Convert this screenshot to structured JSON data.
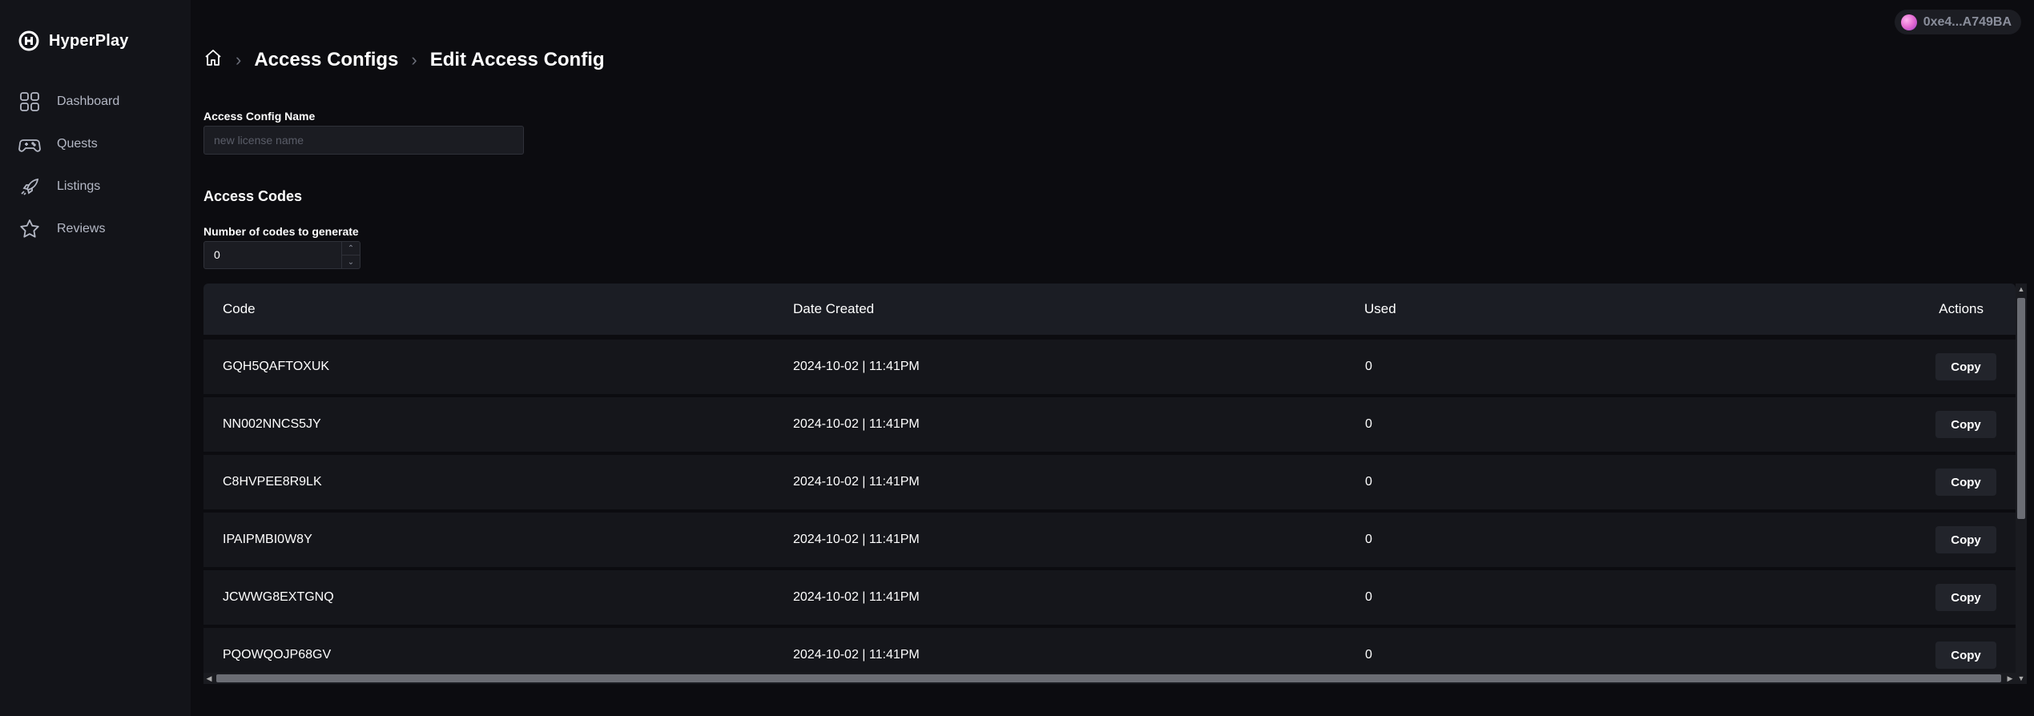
{
  "app": {
    "name": "HyperPlay"
  },
  "sidebar": {
    "items": [
      {
        "label": "Dashboard",
        "icon": "dashboard-icon"
      },
      {
        "label": "Quests",
        "icon": "gamepad-icon"
      },
      {
        "label": "Listings",
        "icon": "rocket-icon"
      },
      {
        "label": "Reviews",
        "icon": "star-icon"
      }
    ]
  },
  "wallet": {
    "address": "0xe4...A749BA"
  },
  "breadcrumb": {
    "home_icon": "home-icon",
    "items": [
      "Access Configs",
      "Edit Access Config"
    ]
  },
  "form": {
    "name_label": "Access Config Name",
    "name_value": "",
    "name_placeholder": "new license name",
    "section_title": "Access Codes",
    "count_label": "Number of codes to generate",
    "count_value": "0"
  },
  "table": {
    "columns": [
      "Code",
      "Date Created",
      "Used",
      "Actions"
    ],
    "rows": [
      {
        "code": "GQH5QAFTOXUK",
        "date": "2024-10-02 | 11:41PM",
        "used": "0",
        "action": "Copy"
      },
      {
        "code": "NN002NNCS5JY",
        "date": "2024-10-02 | 11:41PM",
        "used": "0",
        "action": "Copy"
      },
      {
        "code": "C8HVPEE8R9LK",
        "date": "2024-10-02 | 11:41PM",
        "used": "0",
        "action": "Copy"
      },
      {
        "code": "IPAIPMBI0W8Y",
        "date": "2024-10-02 | 11:41PM",
        "used": "0",
        "action": "Copy"
      },
      {
        "code": "JCWWG8EXTGNQ",
        "date": "2024-10-02 | 11:41PM",
        "used": "0",
        "action": "Copy"
      },
      {
        "code": "PQOWQOJP68GV",
        "date": "2024-10-02 | 11:41PM",
        "used": "0",
        "action": "Copy"
      }
    ]
  },
  "colors": {
    "background": "#0c0c10",
    "sidebar": "#131419",
    "accent_text": "#ffffff",
    "muted_text": "#b4b8c5"
  }
}
